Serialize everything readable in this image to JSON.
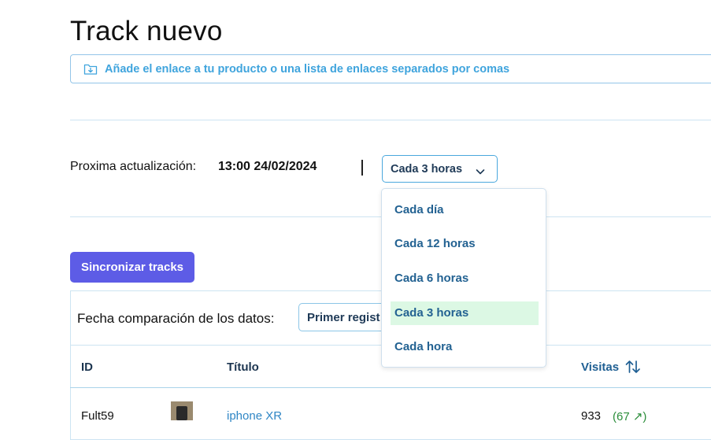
{
  "page": {
    "title": "Track nuevo"
  },
  "link_input": {
    "placeholder": "Añade el enlace a tu producto o una lista de enlaces separados por comas",
    "icon": "download-folder-icon"
  },
  "update": {
    "label": "Proxima actualización:",
    "value": "13:00 24/02/2024"
  },
  "frequency": {
    "selected": "Cada 3 horas",
    "options": [
      "Cada día",
      "Cada 12 horas",
      "Cada 6 horas",
      "Cada 3 horas",
      "Cada hora"
    ],
    "highlight_color": "#dcf8e4"
  },
  "sync_button": {
    "label": "Sincronizar tracks",
    "color": "#5d5ce6"
  },
  "comparison": {
    "label": "Fecha comparación de los datos:",
    "selected": "Primer regist"
  },
  "table": {
    "columns": {
      "id": "ID",
      "title": "Título",
      "visits": "Visitas"
    },
    "rows": [
      {
        "id": "Fult59",
        "title": "iphone XR",
        "visits": "933",
        "delta": "(67 ↗)"
      }
    ]
  }
}
